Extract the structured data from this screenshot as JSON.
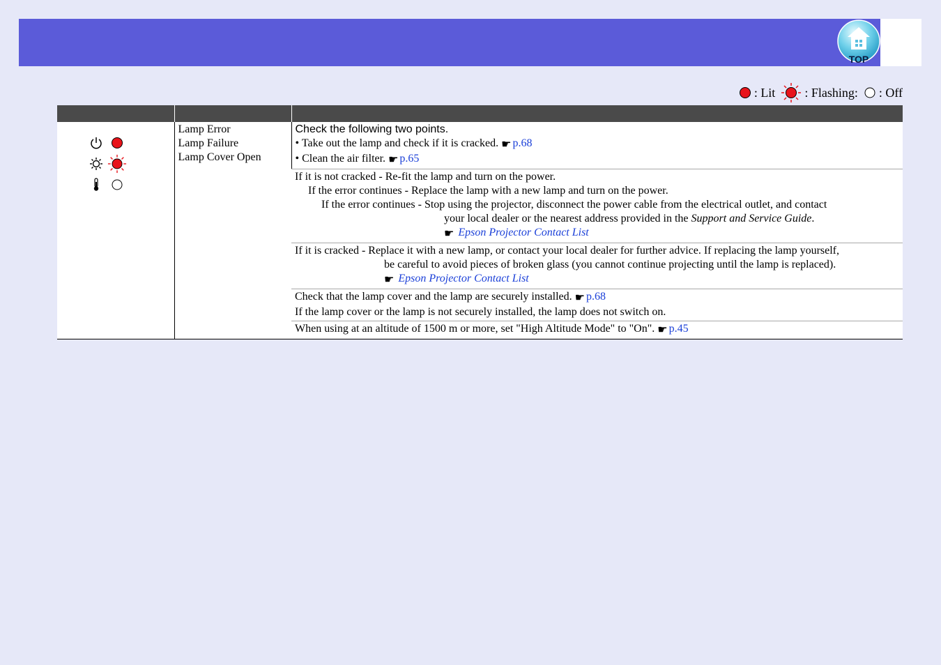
{
  "header": {
    "top_button_label": "TOP",
    "bar_color": "#5b5bd9"
  },
  "legend": {
    "lit_label": ": Lit",
    "flashing_label": ": Flashing:",
    "off_label": ": Off",
    "lit_color": "#e8141b"
  },
  "table": {
    "headers": [
      "",
      "",
      ""
    ],
    "indicators": [
      {
        "icon": "power-icon",
        "state": "lit"
      },
      {
        "icon": "lamp-icon",
        "state": "flashing"
      },
      {
        "icon": "temp-icon",
        "state": "off"
      }
    ],
    "status_lines": [
      "Lamp Error",
      "Lamp Failure",
      "Lamp Cover Open"
    ],
    "block1": {
      "intro": "Check the following two points.",
      "bullet1": "•  Take out the lamp and check if it is cracked.",
      "bullet1_link": "p.68",
      "bullet2": "•  Clean the air filter.",
      "bullet2_link": "p.65"
    },
    "block2": {
      "line1": "If it is not cracked - Re-fit the lamp and turn on the power.",
      "line2": "If the error continues - Replace the lamp with a new lamp and turn on the power.",
      "line3": "If the error continues - Stop using the projector, disconnect the power cable from the electrical outlet, and contact",
      "line4_pre": "your local dealer or the nearest address provided in the ",
      "line4_ital": "Support and Service Guide",
      "line4_post": ".",
      "link": "Epson Projector Contact List"
    },
    "block3": {
      "line1": "If it is cracked - Replace it with a new lamp, or contact your local dealer for further advice. If replacing the lamp yourself,",
      "line2": "be careful to avoid pieces of broken glass (you cannot continue projecting until the lamp is replaced).",
      "link": "Epson Projector Contact List"
    },
    "block4": {
      "line1": "Check that the lamp cover and the lamp are securely installed.",
      "line1_link": "p.68",
      "line2": "If the lamp cover or the lamp is not securely installed, the lamp does not switch on."
    },
    "block5": {
      "line1": "When using at an altitude of 1500 m or more, set \"High Altitude Mode\" to \"On\".",
      "line1_link": "p.45"
    }
  }
}
